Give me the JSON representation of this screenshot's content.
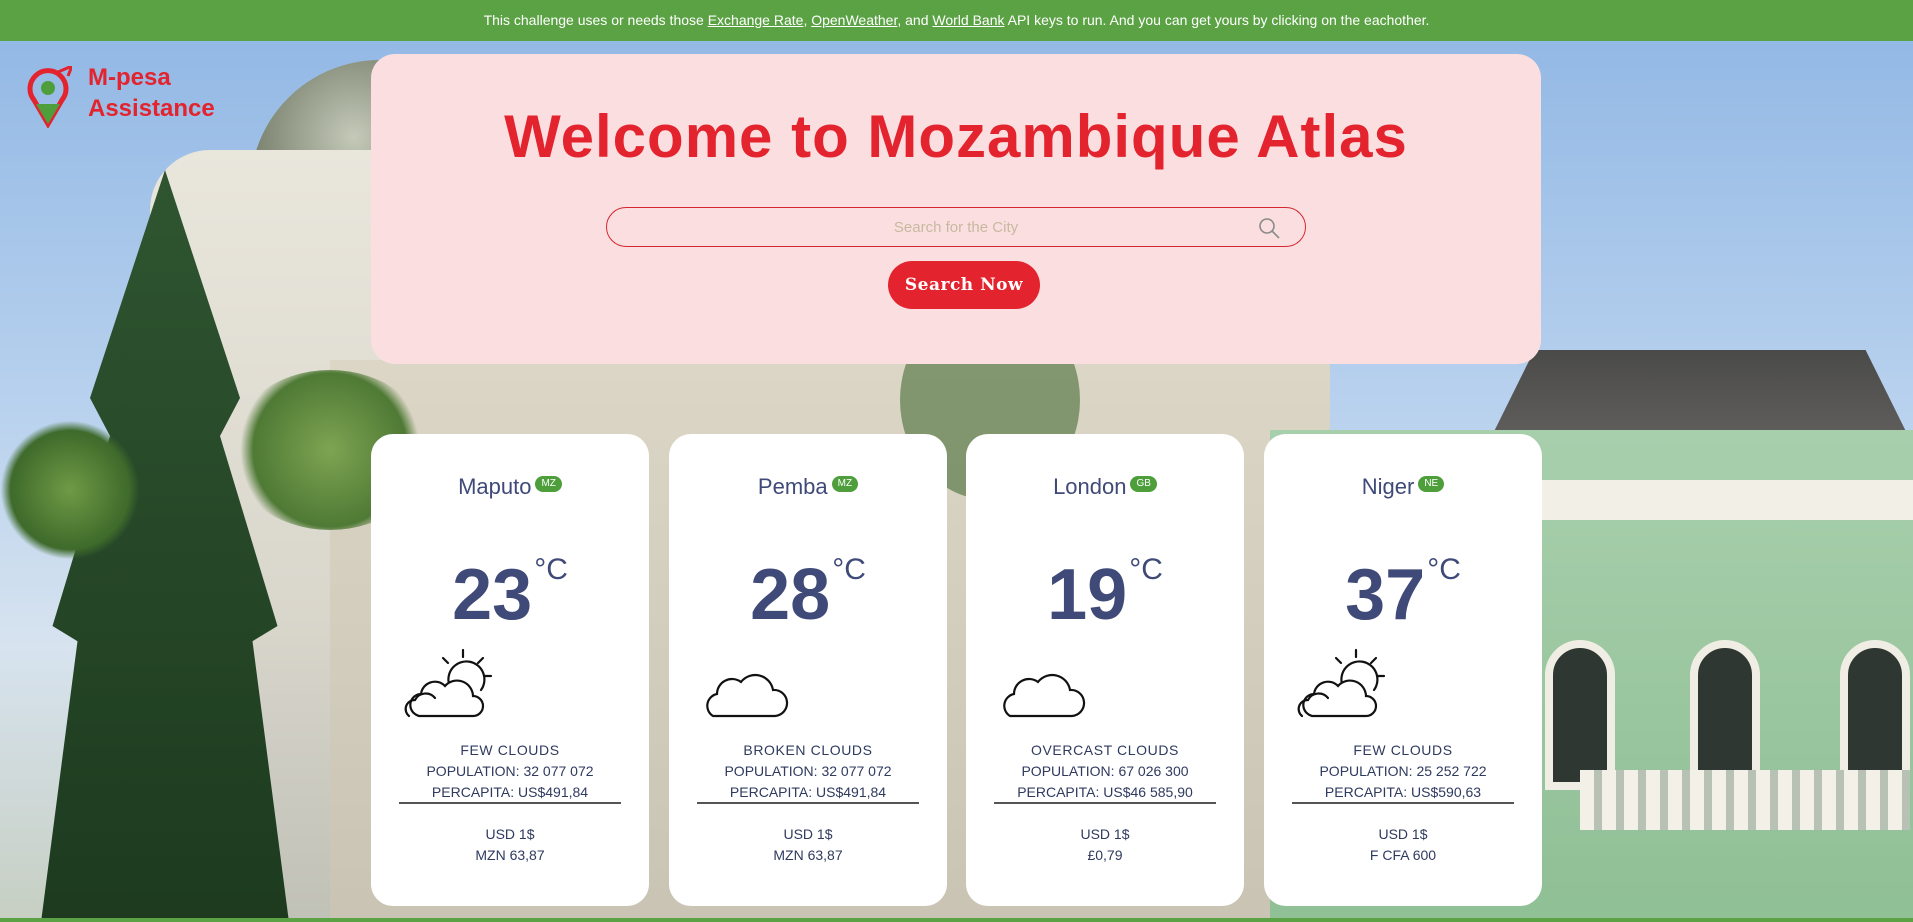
{
  "notice": {
    "prefix": "This challenge uses or needs those ",
    "link1": "Exchange Rate",
    "sep1": ", ",
    "link2": "OpenWeather",
    "sep2": ", and ",
    "link3": "World Bank",
    "suffix": " API keys to run. And you can get yours by clicking on the eachother."
  },
  "logo": {
    "line1": "M-pesa",
    "line2": "Assistance",
    "icon": "location-pin-icon"
  },
  "hero": {
    "title": "Welcome to Mozambique Atlas",
    "search_placeholder": "Search for the City",
    "search_button": "Search Now"
  },
  "colors": {
    "accent_red": "#e3232d",
    "notice_green": "#5ba244",
    "hero_bg": "#fbdfe0",
    "card_text": "#3f4a78",
    "badge_green": "#4e9e3c"
  },
  "cards": [
    {
      "city": "Maputo",
      "country": "MZ",
      "temp": "23",
      "unit": "°C",
      "icon": "sun-behind-clouds-icon",
      "condition": "few clouds",
      "population": "POPULATION: 32 077 072",
      "percapita": "PERCAPITA: US$491,84",
      "fx_base": "USD 1$",
      "fx_value": "MZN 63,87"
    },
    {
      "city": "Pemba",
      "country": "MZ",
      "temp": "28",
      "unit": "°C",
      "icon": "cloud-icon",
      "condition": "broken clouds",
      "population": "POPULATION: 32 077 072",
      "percapita": "PERCAPITA: US$491,84",
      "fx_base": "USD 1$",
      "fx_value": "MZN 63,87"
    },
    {
      "city": "London",
      "country": "GB",
      "temp": "19",
      "unit": "°C",
      "icon": "cloud-icon",
      "condition": "overcast clouds",
      "population": "POPULATION: 67 026 300",
      "percapita": "PERCAPITA: US$46 585,90",
      "fx_base": "USD 1$",
      "fx_value": "£0,79"
    },
    {
      "city": "Niger",
      "country": "NE",
      "temp": "37",
      "unit": "°C",
      "icon": "sun-behind-clouds-icon",
      "condition": "few clouds",
      "population": "POPULATION: 25 252 722",
      "percapita": "PERCAPITA: US$590,63",
      "fx_base": "USD 1$",
      "fx_value": "F CFA 600"
    }
  ]
}
